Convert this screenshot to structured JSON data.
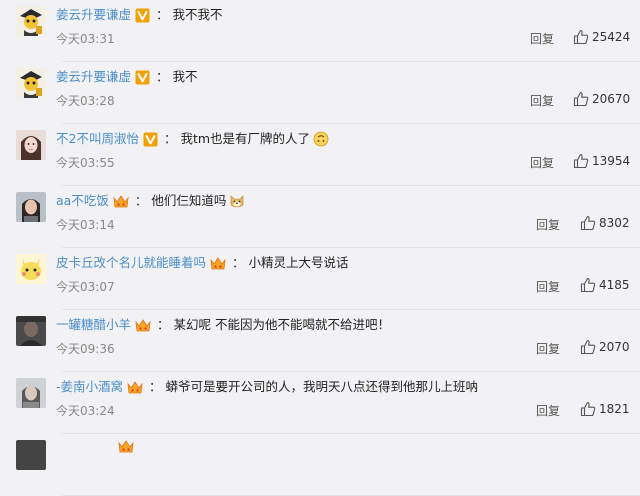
{
  "comments": [
    {
      "username": "姜云升要谦虚",
      "badge": "v",
      "content": "我不我不",
      "emoji": "",
      "time": "今天03:31",
      "reply": "回复",
      "likes": "25424",
      "avatar": "avatar-cartoon-icon"
    },
    {
      "username": "姜云升要谦虚",
      "badge": "v",
      "content": "我不",
      "emoji": "",
      "time": "今天03:28",
      "reply": "回复",
      "likes": "20670",
      "avatar": "avatar-cartoon-icon"
    },
    {
      "username": "不2不叫周淑怡",
      "badge": "v",
      "content": "我tm也是有厂牌的人了",
      "emoji": "upside-down-face",
      "time": "今天03:55",
      "reply": "回复",
      "likes": "13954",
      "avatar": "avatar-girl-icon"
    },
    {
      "username": "aa不吃饭",
      "badge": "crown",
      "content": "他们仨知道吗",
      "emoji": "doge",
      "time": "今天03:14",
      "reply": "回复",
      "likes": "8302",
      "avatar": "avatar-person-icon"
    },
    {
      "username": "皮卡丘改个名儿就能睡着吗",
      "badge": "crown",
      "content": "小精灵上大号说话",
      "emoji": "",
      "time": "今天03:07",
      "reply": "回复",
      "likes": "4185",
      "avatar": "avatar-pikachu-icon"
    },
    {
      "username": "一罐糖醋小羊",
      "badge": "crown",
      "content": "某幻呢 不能因为他不能喝就不给进吧！",
      "emoji": "",
      "time": "今天09:36",
      "reply": "回复",
      "likes": "2070",
      "avatar": "avatar-dark-icon"
    },
    {
      "username": "-姜南小酒窝",
      "badge": "crown",
      "content": "蟒爷可是要开公司的人，我明天八点还得到他那儿上班呐",
      "emoji": "",
      "time": "今天03:24",
      "reply": "回复",
      "likes": "1821",
      "avatar": "avatar-gray-icon"
    }
  ],
  "colors": {
    "username": "#4c8ec8",
    "badge_v": "#f0a000",
    "crown": "#f5a623",
    "text": "#222222",
    "meta": "#888888"
  }
}
